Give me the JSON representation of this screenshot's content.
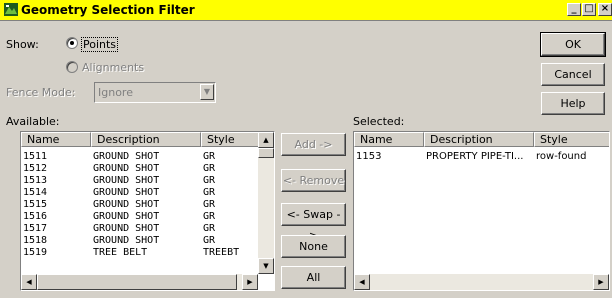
{
  "window": {
    "title": "Geometry Selection Filter",
    "controls": {
      "minimize": "_",
      "maximize": "□",
      "close": "×"
    }
  },
  "show": {
    "label": "Show:",
    "options": [
      {
        "label": "Points",
        "selected": true,
        "enabled": true
      },
      {
        "label": "Alignments",
        "selected": false,
        "enabled": false
      }
    ]
  },
  "fence_mode": {
    "label": "Fence Mode:",
    "value": "Ignore"
  },
  "buttons": {
    "ok": "OK",
    "cancel": "Cancel",
    "help": "Help"
  },
  "available": {
    "label": "Available:",
    "columns": [
      "Name",
      "Description",
      "Style"
    ],
    "rows": [
      [
        "1511",
        "GROUND SHOT",
        "GR"
      ],
      [
        "1512",
        "GROUND SHOT",
        "GR"
      ],
      [
        "1513",
        "GROUND SHOT",
        "GR"
      ],
      [
        "1514",
        "GROUND SHOT",
        "GR"
      ],
      [
        "1515",
        "GROUND SHOT",
        "GR"
      ],
      [
        "1516",
        "GROUND SHOT",
        "GR"
      ],
      [
        "1517",
        "GROUND SHOT",
        "GR"
      ],
      [
        "1518",
        "GROUND SHOT",
        "GR"
      ],
      [
        "1519",
        "TREE BELT",
        "TREEBT"
      ]
    ]
  },
  "mid_buttons": {
    "add": "Add ->",
    "remove": "<- Remove",
    "swap": "<- Swap ->",
    "none": "None",
    "all": "All"
  },
  "selected": {
    "label": "Selected:",
    "columns": [
      "Name",
      "Description",
      "Style"
    ],
    "rows": [
      [
        "1153",
        "PROPERTY PIPE-TI...",
        "row-found"
      ]
    ]
  },
  "colors": {
    "titlebar": "#ffff00",
    "face": "#d4d0c8",
    "list_bg": "#ffffff"
  }
}
